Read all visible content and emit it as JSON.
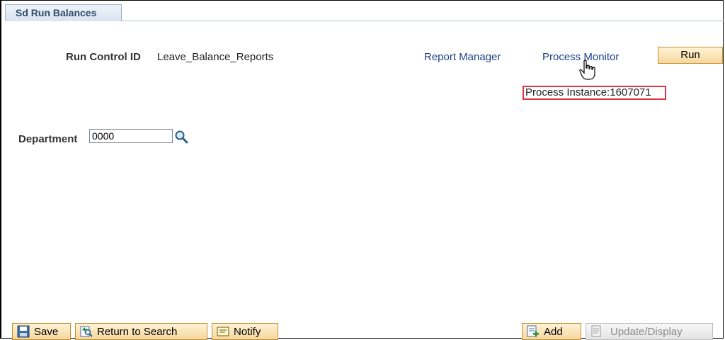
{
  "tab": {
    "label": "Sd Run Balances"
  },
  "header": {
    "run_control_label": "Run Control ID",
    "run_control_value": "Leave_Balance_Reports",
    "report_manager_link": "Report Manager",
    "process_monitor_link": "Process Monitor",
    "run_button": "Run",
    "process_instance": "Process Instance:1607071"
  },
  "form": {
    "department_label": "Department",
    "department_value": "0000"
  },
  "toolbar": {
    "save": "Save",
    "return_to_search": "Return to Search",
    "notify": "Notify",
    "add": "Add",
    "update_display": "Update/Display"
  },
  "colors": {
    "link": "#1f3f8a",
    "button_bg": "#f6d79d",
    "highlight_border": "#d9343f"
  },
  "icons": [
    "lookup-icon",
    "hand-pointer-icon",
    "save-icon",
    "return-to-search-icon",
    "notify-icon",
    "add-icon",
    "update-display-icon"
  ]
}
